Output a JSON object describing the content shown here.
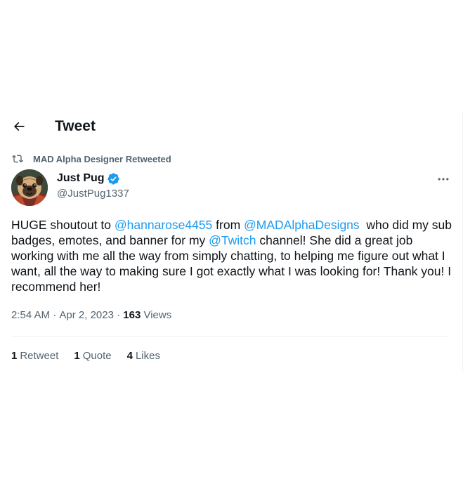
{
  "header": {
    "back_icon": "arrow-left-icon",
    "title": "Tweet"
  },
  "retweet_context": {
    "icon": "retweet-icon",
    "label": "MAD Alpha Designer Retweeted"
  },
  "author": {
    "name": "Just Pug",
    "handle": "@JustPug1337",
    "verified": true,
    "verified_color": "#1d9bf0",
    "avatar_icon": "pug-avatar"
  },
  "more_icon": "more-horizontal-icon",
  "tweet": {
    "text_1": "HUGE shoutout to ",
    "mention_1": "@hannarose4455",
    "text_2": " from ",
    "mention_2": "@MADAlphaDesigns",
    "text_3": "  who did my sub badges, emotes, and banner for my ",
    "mention_3": "@Twitch",
    "text_4": " channel! She did a great job working with me all the way from simply chatting, to helping me figure out what I want, all the way to making sure I got exactly what I was looking for! Thank you! I recommend her!"
  },
  "meta": {
    "time": "2:54 AM",
    "separator": " · ",
    "date": "Apr 2, 2023",
    "views_count": "163",
    "views_label": " Views"
  },
  "stats": {
    "retweets_count": "1",
    "retweets_label": "Retweet",
    "quotes_count": "1",
    "quotes_label": "Quote",
    "likes_count": "4",
    "likes_label": "Likes"
  },
  "colors": {
    "link": "#1d9bf0",
    "text": "#0f1419",
    "secondary": "#536471",
    "border": "#eff3f4"
  }
}
